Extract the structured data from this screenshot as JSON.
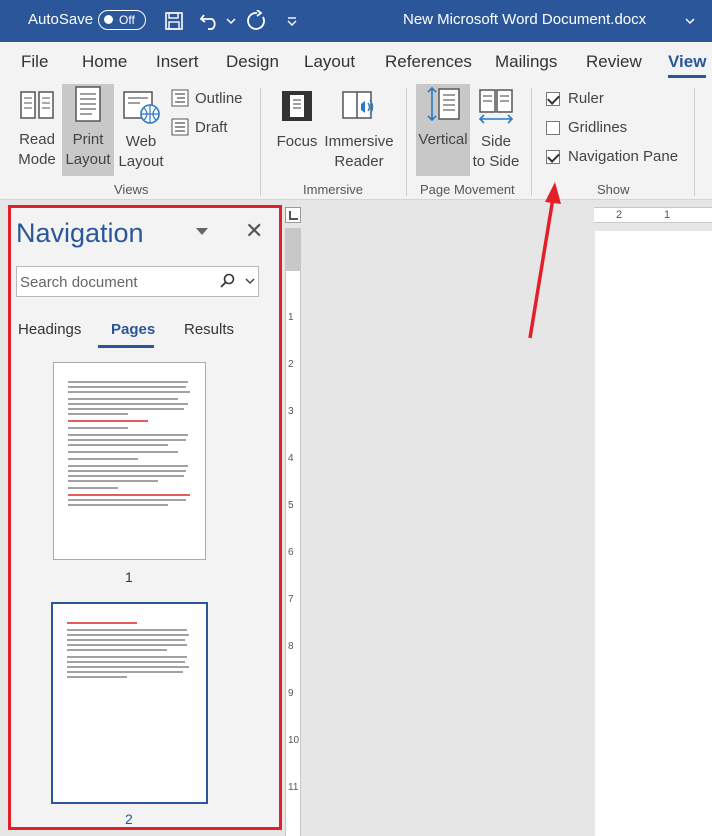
{
  "title_bar": {
    "autosave_label": "AutoSave",
    "autosave_state": "Off",
    "document_title": "New Microsoft Word Document.docx",
    "background_color": "#2b579a"
  },
  "ribbon_tabs": [
    {
      "label": "File"
    },
    {
      "label": "Home"
    },
    {
      "label": "Insert"
    },
    {
      "label": "Design"
    },
    {
      "label": "Layout"
    },
    {
      "label": "References"
    },
    {
      "label": "Mailings"
    },
    {
      "label": "Review"
    },
    {
      "label": "View",
      "active": true
    }
  ],
  "ribbon": {
    "views": {
      "group_label": "Views",
      "read_mode": "Read\nMode",
      "print_layout": "Print\nLayout",
      "web_layout": "Web\nLayout",
      "outline": "Outline",
      "draft": "Draft"
    },
    "immersive": {
      "group_label": "Immersive",
      "focus": "Focus",
      "immersive_reader": "Immersive\nReader"
    },
    "page_movement": {
      "group_label": "Page Movement",
      "vertical": "Vertical",
      "side_to_side": "Side\nto Side"
    },
    "show": {
      "group_label": "Show",
      "ruler": {
        "label": "Ruler",
        "checked": true
      },
      "gridlines": {
        "label": "Gridlines",
        "checked": false
      },
      "navigation_pane": {
        "label": "Navigation Pane",
        "checked": true
      }
    }
  },
  "navigation_pane": {
    "title": "Navigation",
    "search_placeholder": "Search document",
    "tabs": [
      {
        "label": "Headings"
      },
      {
        "label": "Pages",
        "active": true
      },
      {
        "label": "Results"
      }
    ],
    "pages": [
      {
        "number": "1",
        "selected": false
      },
      {
        "number": "2",
        "selected": true
      }
    ],
    "highlight_color": "#e3202a"
  },
  "rulers": {
    "horizontal_numbers": [
      "2",
      "1"
    ],
    "vertical_numbers": [
      "1",
      "2",
      "3",
      "4",
      "5",
      "6",
      "7",
      "8",
      "9",
      "10",
      "11"
    ]
  },
  "colors": {
    "accent": "#2b579a",
    "annotation_red": "#e3202a"
  }
}
